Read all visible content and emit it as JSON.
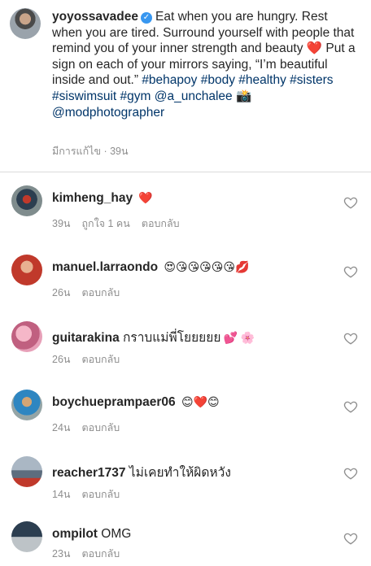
{
  "caption": {
    "username": "yoyossavadee",
    "text_1": "Eat when you are hungry. Rest when you are tired.  Surround yourself with people that remind you of your inner strength and beauty",
    "heart": "❤️",
    "text_2": "Put a sign on each of your mirrors saying, “I’m beautiful inside and out.”",
    "hashtags": "#behapoy #body #healthy #sisters #siswimsuit #gym",
    "mention_1": "@a_unchalee",
    "camera": "📸",
    "mention_2": "@modphotographer",
    "meta": "มีการแก้ไข · 39น"
  },
  "comments": [
    {
      "username": "kimheng_hay",
      "text": "",
      "emoji": "❤️",
      "time": "39น",
      "likes": "ถูกใจ 1 คน",
      "reply": "ตอบกลับ"
    },
    {
      "username": "manuel.larraondo",
      "text": "",
      "emoji": "😍😘😘😘😘😘💋",
      "time": "26น",
      "likes": "",
      "reply": "ตอบกลับ"
    },
    {
      "username": "guitarakina",
      "text": "กราบแม่พี่โยยยยย",
      "emoji": "💕 🌸",
      "time": "26น",
      "likes": "",
      "reply": "ตอบกลับ"
    },
    {
      "username": "boychueprampaer06",
      "text": "",
      "emoji": "😊❤️😊",
      "time": "24น",
      "likes": "",
      "reply": "ตอบกลับ"
    },
    {
      "username": "reacher1737",
      "text": "ไม่เคยทำให้ผิดหวัง",
      "emoji": "",
      "time": "14น",
      "likes": "",
      "reply": "ตอบกลับ"
    },
    {
      "username": "ompilot",
      "text": "OMG",
      "emoji": "",
      "time": "23น",
      "likes": "",
      "reply": "ตอบกลับ"
    }
  ],
  "colors": {
    "text": "#262626",
    "meta": "#8e8e8e",
    "link": "#003569",
    "verified": "#3897f0"
  },
  "icons": {
    "verified": "verified-badge-icon",
    "like": "heart-outline-icon"
  }
}
